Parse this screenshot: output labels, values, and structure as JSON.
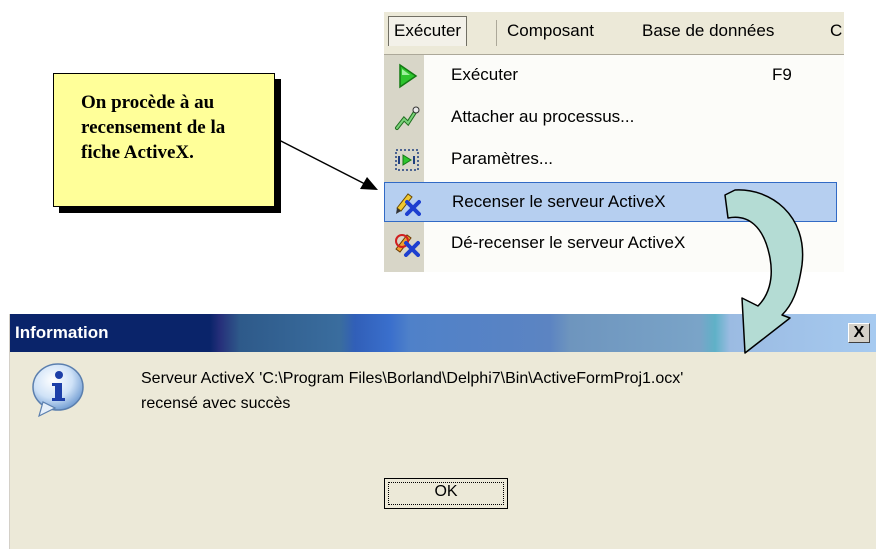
{
  "callout": {
    "lines": [
      "On procède à au",
      "recensement de la",
      "fiche ActiveX."
    ]
  },
  "menubar": {
    "items": [
      "Exécuter",
      "Composant",
      "Base de données",
      "C"
    ]
  },
  "menu": {
    "items": [
      {
        "label": "Exécuter",
        "shortcut": "F9",
        "icon": "run-icon"
      },
      {
        "label": "Attacher au processus...",
        "icon": "attach-icon"
      },
      {
        "label": "Paramètres...",
        "icon": "parameters-icon"
      },
      {
        "label": "Recenser le serveur ActiveX",
        "icon": "register-activex-icon",
        "highlighted": true
      },
      {
        "label": "Dé-recenser le serveur ActiveX",
        "icon": "unregister-activex-icon"
      }
    ]
  },
  "dialog": {
    "title": "Information",
    "close_label": "X",
    "message_line1": "Serveur ActiveX 'C:\\Program Files\\Borland\\Delphi7\\Bin\\ActiveFormProj1.ocx'",
    "message_line2": "recensé avec succès",
    "ok_label": "OK",
    "icon": "information-icon"
  },
  "colors": {
    "callout_bg": "#ffff99",
    "menu_highlight": "#b6cff0",
    "title_bar_start": "#0a246a",
    "title_bar_end": "#a6caf0",
    "arrow_fill": "#b4dcd4"
  }
}
